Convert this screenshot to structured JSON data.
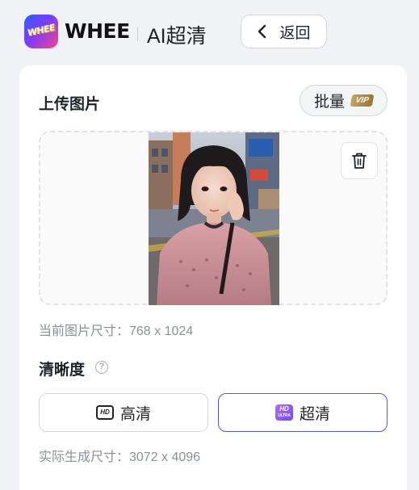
{
  "header": {
    "logo_text": "WHEE",
    "brand": "WHEE",
    "page_title": "AI超清",
    "back_label": "返回"
  },
  "upload": {
    "title": "上传图片",
    "batch_label": "批量",
    "vip_label": "VIP",
    "current_size": "当前图片尺寸：768 x 1024"
  },
  "clarity": {
    "title": "清晰度",
    "help": "?",
    "options": [
      {
        "label": "高清",
        "icon": "hd-icon",
        "selected": false
      },
      {
        "label": "超清",
        "icon": "hd-plus-icon",
        "selected": true
      }
    ],
    "hd_icon_text": "HD",
    "hd_plus_icon_text": "HD",
    "hd_plus_sub": "ULTRA",
    "output_size": "实际生成尺寸：3072 x 4096"
  },
  "colors": {
    "accent": "#4f56e8",
    "background": "#f1f2f5"
  }
}
